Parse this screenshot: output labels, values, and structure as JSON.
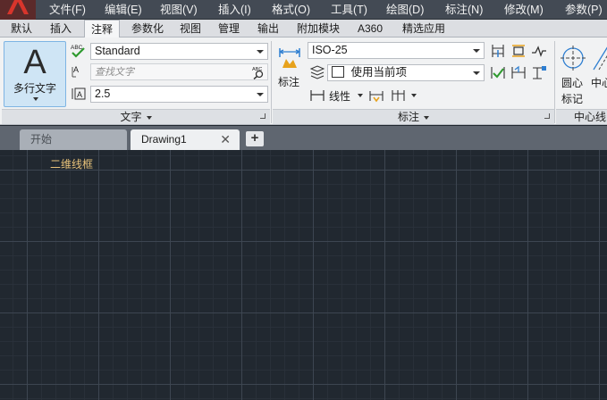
{
  "menu": [
    "文件(F)",
    "编辑(E)",
    "视图(V)",
    "插入(I)",
    "格式(O)",
    "工具(T)",
    "绘图(D)",
    "标注(N)",
    "修改(M)",
    "参数(P)"
  ],
  "ribbon_tabs": [
    "默认",
    "插入",
    "注释",
    "参数化",
    "视图",
    "管理",
    "输出",
    "附加模块",
    "A360",
    "精选应用"
  ],
  "active_tab": "注释",
  "text_panel": {
    "multiline_text_label": "多行文字",
    "text_style": "Standard",
    "find_text_placeholder": "查找文字",
    "text_height": "2.5",
    "panel_title": "文字"
  },
  "dimension_panel": {
    "dimension_label": "标注",
    "dim_style": "ISO-25",
    "layer_value": "使用当前项",
    "linear_label": "线性",
    "panel_title": "标注"
  },
  "centerline_panel": {
    "center_mark_label_1": "圆心",
    "center_mark_label_2": "标记",
    "center_line_label": "中心",
    "panel_title": "中心线"
  },
  "file_tabs": {
    "start": "开始",
    "drawing": "Drawing1",
    "close_glyph": "✕",
    "new_glyph": "+"
  },
  "viewport": {
    "view_style": "二维线框"
  },
  "colors": {
    "menubar": "#434a54",
    "canvas": "#212830",
    "accent_blue": "#2f7fd1",
    "view_label": "#e8c27a"
  }
}
